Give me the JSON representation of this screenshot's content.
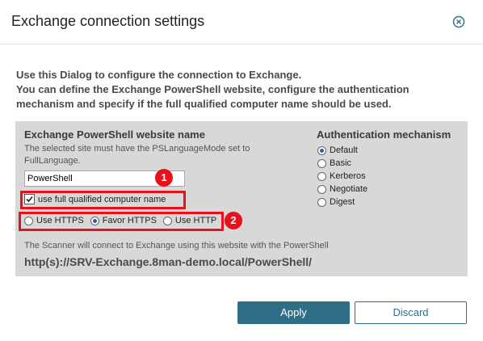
{
  "dialog": {
    "title": "Exchange connection settings",
    "close_icon": "close-circle-icon",
    "intro_line1": "Use this Dialog to configure the connection to Exchange.",
    "intro_line2": "You can define the Exchange PowerShell website, configure the authentication mechanism and specify if the full qualified computer name should be used."
  },
  "website": {
    "heading": "Exchange PowerShell website name",
    "hint": "The selected site must have the PSLanguageMode set to FullLanguage.",
    "value": "PowerShell",
    "fqdn_label": "use full qualified computer name",
    "fqdn_checked": true,
    "protocols": [
      {
        "label": "Use HTTPS",
        "selected": false
      },
      {
        "label": "Favor HTTPS",
        "selected": true
      },
      {
        "label": "Use HTTP",
        "selected": false
      }
    ],
    "info": "The Scanner will connect to Exchange using this website with the PowerShell",
    "url": "http(s)://SRV-Exchange.8man-demo.local/PowerShell/"
  },
  "auth": {
    "heading": "Authentication mechanism",
    "options": [
      {
        "label": "Default",
        "selected": true
      },
      {
        "label": "Basic",
        "selected": false
      },
      {
        "label": "Kerberos",
        "selected": false
      },
      {
        "label": "Negotiate",
        "selected": false
      },
      {
        "label": "Digest",
        "selected": false
      }
    ]
  },
  "annotations": {
    "badge1": "1",
    "badge2": "2",
    "color": "#e8101a"
  },
  "buttons": {
    "apply": "Apply",
    "discard": "Discard"
  }
}
